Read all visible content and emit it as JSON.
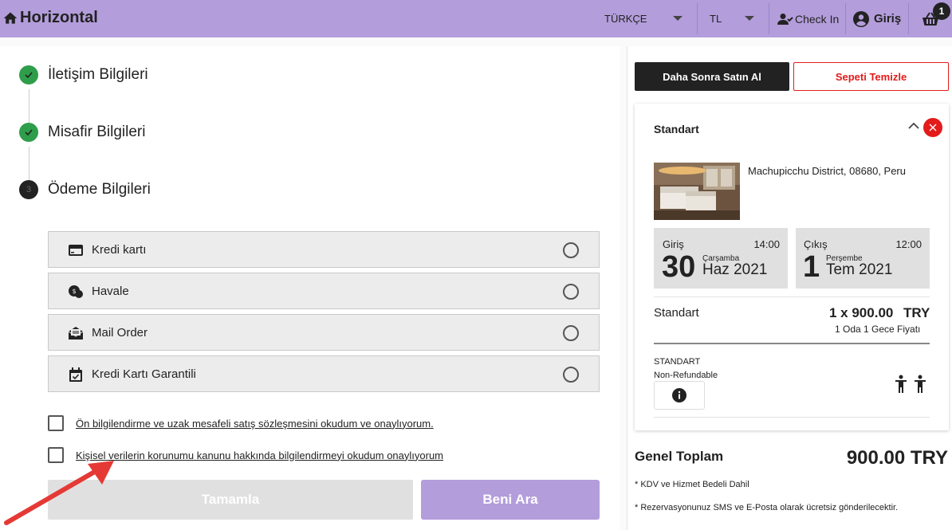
{
  "header": {
    "brand": "Horizontal",
    "language": "TÜRKÇE",
    "currency": "TL",
    "checkin": "Check In",
    "login": "Giriş",
    "cart_count": "1"
  },
  "steps": [
    {
      "label": "İletişim Bilgileri",
      "status": "done"
    },
    {
      "label": "Misafir Bilgileri",
      "status": "done"
    },
    {
      "label": "Ödeme Bilgileri",
      "status": "active",
      "number": "3"
    }
  ],
  "payment_options": [
    {
      "label": "Kredi kartı",
      "icon": "credit-card-icon"
    },
    {
      "label": "Havale",
      "icon": "transfer-icon"
    },
    {
      "label": "Mail Order",
      "icon": "mail-icon"
    },
    {
      "label": "Kredi Kartı Garantili",
      "icon": "calendar-check-icon"
    }
  ],
  "agreements": [
    "Ön bilgilendirme ve uzak mesafeli satış sözleşmesini okudum ve onaylıyorum.",
    "Kişisel verilerin korunumu kanunu hakkında bilgilendirmeyi okudum onaylıyorum"
  ],
  "buttons": {
    "complete": "Tamamla",
    "call_me": "Beni Ara",
    "buy_later": "Daha Sonra Satın Al",
    "clear_cart": "Sepeti Temizle"
  },
  "cart_item": {
    "room_title": "Standart",
    "address": "Machupicchu District, 08680, Peru",
    "checkin": {
      "label": "Giriş",
      "time": "14:00",
      "day": "30",
      "weekday": "Çarşamba",
      "month_year": "Haz 2021"
    },
    "checkout": {
      "label": "Çıkış",
      "time": "12:00",
      "day": "1",
      "weekday": "Perşembe",
      "month_year": "Tem 2021"
    },
    "room_name": "Standart",
    "price": "1 x 900.00",
    "currency": "TRY",
    "price_note": "1 Oda 1 Gece Fiyatı",
    "rate_code": "STANDART",
    "rate_policy": "Non-Refundable"
  },
  "totals": {
    "label": "Genel Toplam",
    "amount": "900.00 TRY",
    "note1": "* KDV ve Hizmet Bedeli Dahil",
    "note2": "* Rezervasyonunuz SMS ve E-Posta olarak ücretsiz gönderilecektir."
  },
  "colors": {
    "accent": "#b39ddb",
    "success": "#2e9e4a",
    "danger": "#e31b1b",
    "annotation_arrow": "#e53935"
  }
}
